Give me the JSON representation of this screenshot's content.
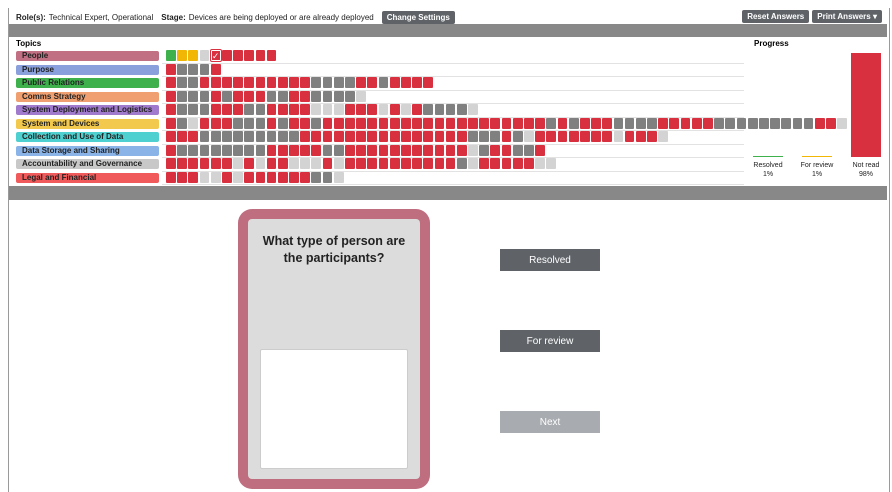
{
  "header": {
    "roles_label": "Role(s):",
    "roles_value": "Technical Expert, Operational",
    "stage_label": "Stage:",
    "stage_value": "Devices are being deployed or are already deployed",
    "change_settings": "Change Settings",
    "reset_answers": "Reset Answers",
    "print_answers": "Print Answers",
    "print_caret_icon": "caret-down-icon"
  },
  "topics_heading": "Topics",
  "progress_heading": "Progress",
  "topics": [
    {
      "label": "People",
      "color": "#c07082",
      "cells": "ny yl x rrrrr"
    },
    {
      "label": "Purpose",
      "color": "#8aa0dc",
      "cells": "rgggr"
    },
    {
      "label": "Public Relations",
      "color": "#3eb04c",
      "cells": "rggrrrrrrrrrrggggrrgrrrr"
    },
    {
      "label": "Comms Strategy",
      "color": "#f0a070",
      "cells": "rgggrgrrrggrrggggl"
    },
    {
      "label": "System Deployment and Logistics",
      "color": "#a07acc",
      "cells": "rgggrrrggrrrrlllrrrlrlrggggl"
    },
    {
      "label": "System and Devices",
      "color": "#f2c94c",
      "cells": "rglrrrgggrgrrgrrrrrrrrrrrrrrrrrrrrgrgrrrggggrrrrrgggggggggrrl"
    },
    {
      "label": "Collection and Use of Data",
      "color": "#4fd0d0",
      "cells": "rrrgggggggggrrrrrrrrrrrrrrrgggrglrrrrrrrlrrrl"
    },
    {
      "label": "Data Storage and Sharing",
      "color": "#8ab4e8",
      "cells": "rggggggggrrrrrggrrrrrrrrrrrlgrrggr"
    },
    {
      "label": "Accountability and Governance",
      "color": "#c8c8c8",
      "cells": "rrrrrrlrlrrlllrlrrrrrrrrrrglrrrrrll"
    },
    {
      "label": "Legal and Financial",
      "color": "#f05a5a",
      "cells": "rrrllrlrrrrrrggl"
    }
  ],
  "progress": [
    {
      "label": "Resolved",
      "pct": "1%",
      "fraction": 0.01,
      "color": "#3eb04c"
    },
    {
      "label": "For review",
      "pct": "1%",
      "fraction": 0.01,
      "color": "#f2b705"
    },
    {
      "label": "Not read",
      "pct": "98%",
      "fraction": 0.98,
      "color": "#d9303f"
    }
  ],
  "card": {
    "question": "What type of person are the participants?",
    "answer_value": ""
  },
  "actions": {
    "resolved": "Resolved",
    "for_review": "For review",
    "next": "Next"
  },
  "colors": {
    "accent_dark": "#5f6368",
    "card_border": "#bf6e80",
    "next_disabled": "#a8abaf"
  }
}
